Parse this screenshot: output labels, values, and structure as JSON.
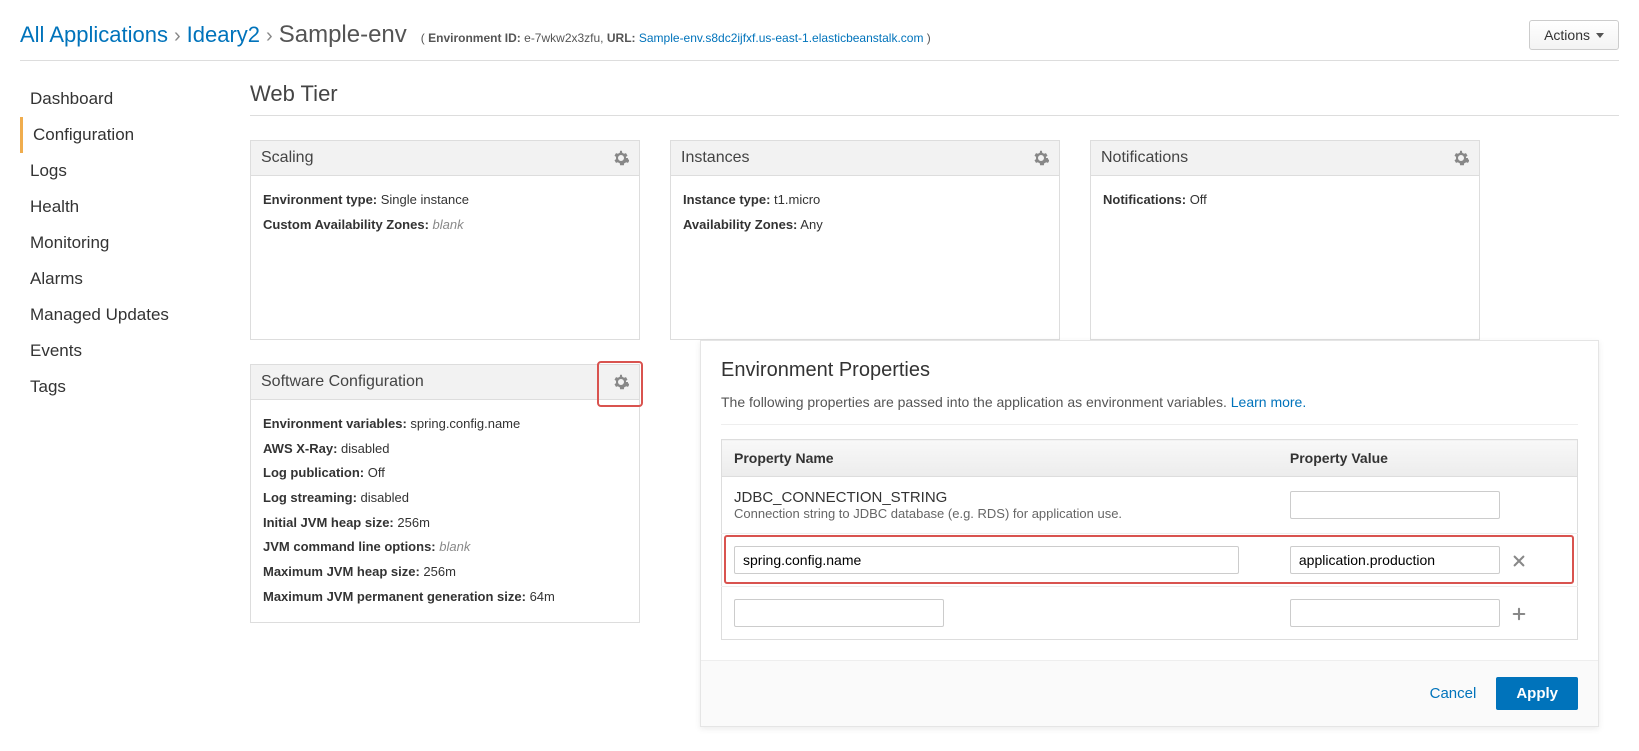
{
  "breadcrumb": {
    "all_apps": "All Applications",
    "app": "Ideary2",
    "env": "Sample-env",
    "env_id_label": "Environment ID:",
    "env_id": "e-7wkw2x3zfu,",
    "url_label": "URL:",
    "url": "Sample-env.s8dc2ijfxf.us-east-1.elasticbeanstalk.com",
    "close_paren": ")"
  },
  "actions_label": "Actions",
  "sidebar": {
    "items": [
      {
        "label": "Dashboard"
      },
      {
        "label": "Configuration"
      },
      {
        "label": "Logs"
      },
      {
        "label": "Health"
      },
      {
        "label": "Monitoring"
      },
      {
        "label": "Alarms"
      },
      {
        "label": "Managed Updates"
      },
      {
        "label": "Events"
      },
      {
        "label": "Tags"
      }
    ],
    "active_index": 1
  },
  "section_title": "Web Tier",
  "cards": {
    "scaling": {
      "title": "Scaling",
      "env_type_label": "Environment type:",
      "env_type": "Single instance",
      "caz_label": "Custom Availability Zones:",
      "caz_value": "blank"
    },
    "instances": {
      "title": "Instances",
      "inst_type_label": "Instance type:",
      "inst_type": "t1.micro",
      "az_label": "Availability Zones:",
      "az_value": "Any"
    },
    "notifications": {
      "title": "Notifications",
      "notif_label": "Notifications:",
      "notif_value": "Off"
    },
    "software": {
      "title": "Software Configuration",
      "envvars_label": "Environment variables:",
      "envvars_value": "spring.config.name",
      "xray_label": "AWS X-Ray:",
      "xray_value": "disabled",
      "logpub_label": "Log publication:",
      "logpub_value": "Off",
      "logstream_label": "Log streaming:",
      "logstream_value": "disabled",
      "initheap_label": "Initial JVM heap size:",
      "initheap_value": "256m",
      "jvmcli_label": "JVM command line options:",
      "jvmcli_value": "blank",
      "maxheap_label": "Maximum JVM heap size:",
      "maxheap_value": "256m",
      "maxperm_label": "Maximum JVM permanent generation size:",
      "maxperm_value": "64m"
    }
  },
  "props": {
    "title": "Environment Properties",
    "desc": "The following properties are passed into the application as environment variables.",
    "learn_more": "Learn more.",
    "th_name": "Property Name",
    "th_value": "Property Value",
    "rows": [
      {
        "name": "JDBC_CONNECTION_STRING",
        "sub": "Connection string to JDBC database (e.g. RDS) for application use.",
        "value": ""
      },
      {
        "name": "spring.config.name",
        "sub": "",
        "value": "application.production"
      }
    ],
    "cancel": "Cancel",
    "apply": "Apply"
  }
}
